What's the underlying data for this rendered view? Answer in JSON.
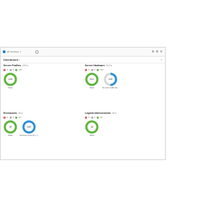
{
  "app": {
    "brand_text": "HP OneView"
  },
  "dashboard": {
    "title": "Dashboard"
  },
  "colors": {
    "ok": "#5bb53b",
    "blue": "#2a8fd6",
    "ring_bg": "#d6d6d6"
  },
  "widgets": [
    {
      "title": "Server Profiles",
      "subtitle": "249 ▸",
      "counts": {
        "critical": "0",
        "warning": "0",
        "ok": "249"
      },
      "donuts": [
        {
          "value": "249",
          "label": "Status",
          "color": "#5bb53b",
          "fraction": 1.0
        }
      ]
    },
    {
      "title": "Server Hardware",
      "subtitle": "512 ▸",
      "counts": {
        "critical": "0",
        "warning": "0",
        "ok": "512"
      },
      "donuts": [
        {
          "value": "512",
          "label": "Status",
          "color": "#5bb53b",
          "fraction": 1.0
        },
        {
          "value": "249",
          "label": "No server profile has...",
          "color": "#2a8fd6",
          "fraction": 0.5
        }
      ]
    },
    {
      "title": "Enclosures",
      "subtitle": "16 ▸",
      "counts": {
        "critical": "0",
        "warning": "0",
        "ok": "16"
      },
      "donuts": [
        {
          "value": "16",
          "label": "Status",
          "color": "#5bb53b",
          "fraction": 1.0
        },
        {
          "value": "16/0",
          "label": "Enclosure Group (by n...)",
          "color": "#2a8fd6",
          "fraction": 1.0
        }
      ]
    },
    {
      "title": "Logical Interconnects",
      "subtitle": "16 ▸",
      "counts": {
        "critical": "0",
        "warning": "0",
        "ok": "16"
      },
      "donuts": [
        {
          "value": "16",
          "label": "Status",
          "color": "#5bb53b",
          "fraction": 1.0
        }
      ]
    }
  ]
}
